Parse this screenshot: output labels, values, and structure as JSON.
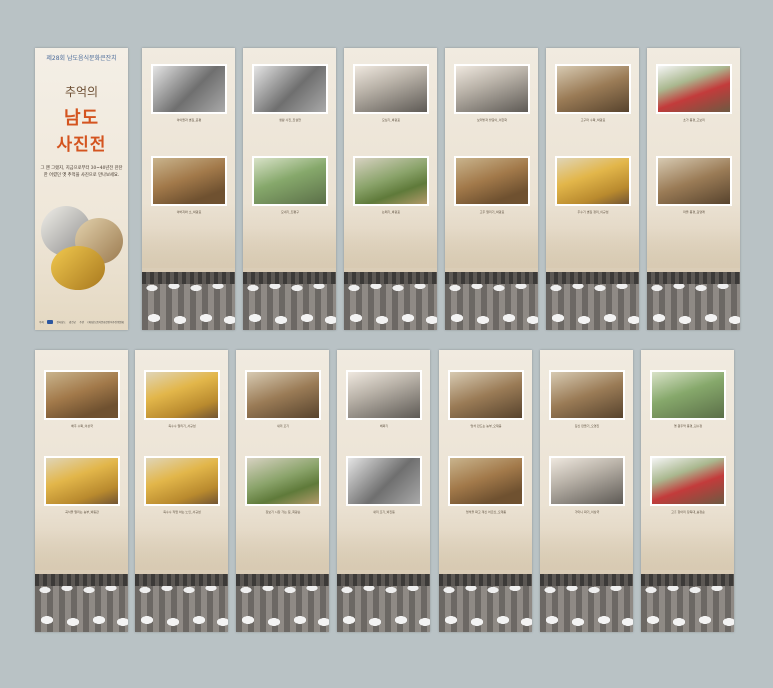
{
  "title_banner": {
    "subtitle": "제28회 남도음식문화큰잔치",
    "title_line1": "추억의",
    "title_line2": "남도",
    "title_line3": "사진전",
    "description": "그 땐 그랬지, 지금으로부터 30~40년전 잔잔한 어렸던 옛 추억을 사진으로 만나보세요.",
    "logos": [
      "주최",
      "전라남도",
      "강진군",
      "주관",
      "(재)남도음식문화큰잔치추진위원회"
    ]
  },
  "banners_top": [
    {
      "captions": [
        "아이들과 볏짚_윤평",
        "아버지와 소_박광표"
      ]
    },
    {
      "captions": [
        "생활 사진_진설현",
        "모내기_진평구"
      ]
    },
    {
      "captions": [
        "모심기_박광표",
        "논매기_박광표"
      ]
    },
    {
      "captions": [
        "보리밭과 밭갈이_이한화",
        "고추 말리기_박광표"
      ]
    },
    {
      "captions": [
        "고구마 수확_박광표",
        "추수기 볏짚 정리_이규섭"
      ]
    },
    {
      "captions": [
        "초가 풍경_고보리",
        "마을 풍경_김영래"
      ]
    }
  ],
  "banners_bottom": [
    {
      "captions": [
        "배추 수확_이상국",
        "곡식을 말리는 농부_박동관"
      ]
    },
    {
      "captions": [
        "옥수수 말리기_서규섭",
        "옥수수 작업 하는 노인_서규섭"
      ]
    },
    {
      "captions": [
        "새끼 꼬기",
        "장보기 시장 가는 길_최광순"
      ]
    },
    {
      "captions": [
        "베짜기",
        "새끼 꼬기_박진동"
      ]
    },
    {
      "captions": [
        "멍석 만드는 농부_오재웅",
        "멍석을 짜고 계신 어르신_오재웅"
      ]
    },
    {
      "captions": [
        "짚신 만들기_오영진",
        "가마니 짜기_이상국"
      ]
    },
    {
      "captions": [
        "옛 원두막 풍경_김수정",
        "고흥 항아리 장독대_송정순"
      ]
    }
  ]
}
